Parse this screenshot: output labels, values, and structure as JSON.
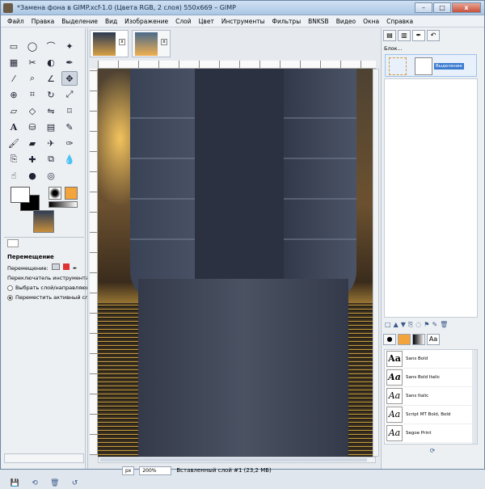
{
  "window": {
    "title": "*Замена фона в GIMP.xcf-1.0 (Цвета RGB, 2 слоя) 550x669 – GIMP",
    "minimize_label": "–",
    "maximize_label": "□",
    "close_label": "x"
  },
  "menu": [
    "Файл",
    "Правка",
    "Выделение",
    "Вид",
    "Изображение",
    "Слой",
    "Цвет",
    "Инструменты",
    "Фильтры",
    "BNKSB",
    "Видео",
    "Окна",
    "Справка"
  ],
  "tool_options": {
    "title": "Перемещение",
    "move_label": "Перемещение:",
    "toggle_label": "Переключатель инструмента (Shift)",
    "option_pick_layer": "Выбрать слой/направляющую",
    "option_move_active": "Переместить активный слой"
  },
  "tools": [
    "rect-select",
    "ellipse-select",
    "free-select",
    "fuzzy-select",
    "color-select",
    "scissors",
    "foreground-select",
    "paths",
    "color-picker",
    "zoom",
    "measure",
    "move",
    "align",
    "crop",
    "rotate",
    "scale",
    "shear",
    "perspective",
    "flip",
    "cage",
    "text",
    "bucket-fill",
    "blend",
    "pencil",
    "paintbrush",
    "eraser",
    "airbrush",
    "ink",
    "clone",
    "heal",
    "perspective-clone",
    "blur",
    "smudge",
    "dodge-burn",
    "unknown",
    "unknown2"
  ],
  "statusbar": {
    "unit": "px",
    "zoom": "200%",
    "message": "Вставленный слой #1 (23,2 МБ)"
  },
  "layers": {
    "label": "Блок...",
    "layer_name": "Выделение"
  },
  "fonts": [
    "Sans Bold",
    "Sans Bold Italic",
    "Sans Italic",
    "Script MT Bold, Bold",
    "Segoe Print"
  ],
  "font_preview": "Aa",
  "colors": {
    "titlebar": "#aac6e4",
    "selection": "#3a7bd0",
    "pattern": "#f3a43a"
  }
}
